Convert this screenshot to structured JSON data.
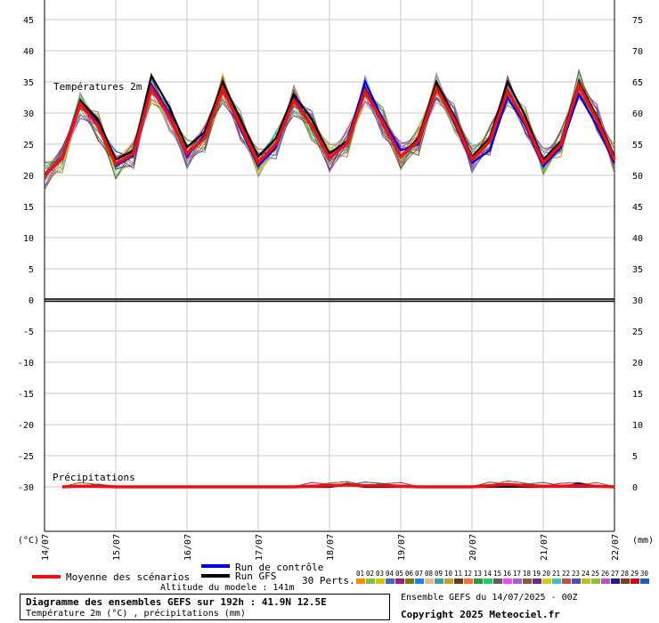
{
  "chart_data": {
    "type": "line",
    "temperature_label": "Températures 2m",
    "precip_label": "Précipitations",
    "left_axis_unit": "(°C)",
    "right_axis_unit": "(mm)",
    "left_ticks": [
      "45",
      "40",
      "35",
      "30",
      "25",
      "20",
      "15",
      "10",
      "5",
      "0",
      "-5",
      "-10",
      "-15",
      "-20",
      "-25",
      "-30"
    ],
    "right_ticks": [
      "75",
      "70",
      "65",
      "60",
      "55",
      "50",
      "45",
      "40",
      "35",
      "30",
      "25",
      "20",
      "15",
      "10",
      "5",
      "0"
    ],
    "temperature_axis": {
      "min": -30,
      "max": 45,
      "step": 5
    },
    "precip_axis": {
      "min": 0,
      "max": 75,
      "step": 5
    },
    "x_ticks": [
      "14/07",
      "15/07",
      "16/07",
      "17/07",
      "18/07",
      "19/07",
      "20/07",
      "21/07",
      "22/07"
    ],
    "x_range_hours": [
      0,
      192
    ],
    "grid": true,
    "zero_line_temperature": 0,
    "series": [
      {
        "name": "Moyenne des scénarios",
        "color": "#ee1111",
        "hours": [
          0,
          6,
          12,
          18,
          24,
          30,
          36,
          42,
          48,
          54,
          60,
          66,
          72,
          78,
          84,
          90,
          96,
          102,
          108,
          114,
          120,
          126,
          132,
          138,
          144,
          150,
          156,
          162,
          168,
          174,
          180,
          186,
          192
        ],
        "temperature": [
          20,
          22.8,
          31.5,
          28,
          21.8,
          23.5,
          34,
          29.5,
          23.5,
          26,
          34,
          28,
          22,
          25,
          32,
          28,
          22.8,
          25.2,
          33.5,
          28.5,
          23,
          25.5,
          34,
          29,
          22.5,
          25.5,
          33.5,
          28.5,
          22,
          25,
          34.5,
          29,
          22.5
        ],
        "precip_hours": [
          6,
          12,
          18,
          24,
          30,
          36,
          42,
          48,
          54,
          60,
          66,
          72,
          78,
          84,
          90,
          96,
          102,
          108,
          114,
          120,
          126,
          132,
          138,
          144,
          150,
          156,
          162,
          168,
          174,
          180,
          186,
          192
        ],
        "precip": [
          0,
          0.1,
          0.1,
          0,
          0,
          0,
          0,
          0,
          0,
          0,
          0,
          0,
          0,
          0,
          0.1,
          0.2,
          0.3,
          0.2,
          0.2,
          0.1,
          0,
          0,
          0,
          0,
          0.2,
          0.4,
          0.2,
          0.1,
          0.1,
          0.2,
          0.1,
          0
        ]
      },
      {
        "name": "Run de contrôle",
        "color": "#0000ee",
        "hours": [
          0,
          6,
          12,
          18,
          24,
          30,
          36,
          42,
          48,
          54,
          60,
          66,
          72,
          78,
          84,
          90,
          96,
          102,
          108,
          114,
          120,
          126,
          132,
          138,
          144,
          150,
          156,
          162,
          168,
          174,
          180,
          186,
          192
        ],
        "temperature": [
          20,
          22.8,
          32,
          28.5,
          21.5,
          23.2,
          34.5,
          30,
          23,
          26.5,
          34.5,
          27.5,
          21.5,
          24.5,
          32.5,
          28,
          23.5,
          25.5,
          35,
          29,
          24,
          25,
          34.5,
          28.5,
          22,
          24,
          32.5,
          28,
          21.5,
          24.5,
          33,
          28,
          22
        ],
        "precip_hours": [
          6,
          12,
          18,
          24,
          30,
          36,
          42,
          48,
          54,
          60,
          66,
          72,
          78,
          84,
          90,
          96,
          102,
          108,
          114,
          120,
          126,
          132,
          138,
          144,
          150,
          156,
          162,
          168,
          174,
          180,
          186,
          192
        ],
        "precip": [
          0,
          0,
          0,
          0,
          0,
          0,
          0,
          0,
          0,
          0,
          0,
          0,
          0,
          0,
          0,
          0,
          0.3,
          0,
          0,
          0,
          0,
          0,
          0,
          0,
          0,
          0.5,
          0,
          0,
          0,
          0,
          0,
          0
        ]
      },
      {
        "name": "Run GFS",
        "color": "#000000",
        "hours": [
          0,
          6,
          12,
          18,
          24,
          30,
          36,
          42,
          48,
          54,
          60,
          66,
          72,
          78,
          84,
          90,
          96,
          102,
          108,
          114,
          120,
          126,
          132,
          138,
          144,
          150,
          156,
          162,
          168,
          174,
          180,
          186,
          192
        ],
        "temperature": [
          20,
          23,
          32,
          29,
          22.5,
          24,
          36,
          31,
          24.5,
          27,
          35,
          29,
          23,
          26,
          33,
          29,
          23.5,
          25.5,
          34,
          28.5,
          23,
          26,
          35,
          29.5,
          23,
          26,
          35,
          29.5,
          22.5,
          25.5,
          35,
          29.5,
          23
        ],
        "precip_hours": [
          6,
          12,
          18,
          24,
          30,
          36,
          42,
          48,
          54,
          60,
          66,
          72,
          78,
          84,
          90,
          96,
          102,
          108,
          114,
          120,
          126,
          132,
          138,
          144,
          150,
          156,
          162,
          168,
          174,
          180,
          186,
          192
        ],
        "precip": [
          0,
          0,
          0,
          0,
          0,
          0,
          0,
          0,
          0,
          0,
          0,
          0,
          0,
          0,
          0,
          0,
          0.5,
          0,
          0,
          0,
          0,
          0,
          0,
          0,
          0,
          0,
          0,
          0,
          0,
          0.5,
          0,
          0
        ]
      }
    ],
    "perturbations_label": "30 Perts.",
    "perturbation_numbers": [
      "01",
      "02",
      "03",
      "04",
      "05",
      "06",
      "07",
      "08",
      "09",
      "10",
      "11",
      "12",
      "13",
      "14",
      "15",
      "16",
      "17",
      "18",
      "19",
      "20",
      "21",
      "22",
      "23",
      "24",
      "25",
      "26",
      "27",
      "28",
      "29",
      "30"
    ],
    "perturbation_colors": [
      "#ff8c00",
      "#7fbf3f",
      "#d8c400",
      "#3f66c8",
      "#9b1f7a",
      "#7a7a00",
      "#1f7fff",
      "#e0c080",
      "#3fa0a0",
      "#c8a030",
      "#5f3f1f",
      "#ff6f2f",
      "#20a040",
      "#1fcf5f",
      "#606060",
      "#ff44ff",
      "#a060e0",
      "#8a5a3a",
      "#6a2a8a",
      "#d0d000",
      "#40c0c0",
      "#c05050",
      "#5050a0",
      "#bfbf1f",
      "#8fbf3f",
      "#c04fc0",
      "#202080",
      "#7f3f1f",
      "#c01010",
      "#1f5fbf"
    ]
  },
  "legend": {
    "mean_label": "Moyenne des scénarios",
    "control_label": "Run de contrôle",
    "gfs_label": "Run GFS",
    "altitude": "Altitude du modele : 141m"
  },
  "footer": {
    "title": "Diagramme des ensembles GEFS sur 192h : 41.9N 12.5E",
    "subtitle": "Température 2m (°C) , précipitations (mm)",
    "ensemble": "Ensemble GEFS du 14/07/2025 - 00Z",
    "copyright": "Copyright 2025 Meteociel.fr"
  }
}
